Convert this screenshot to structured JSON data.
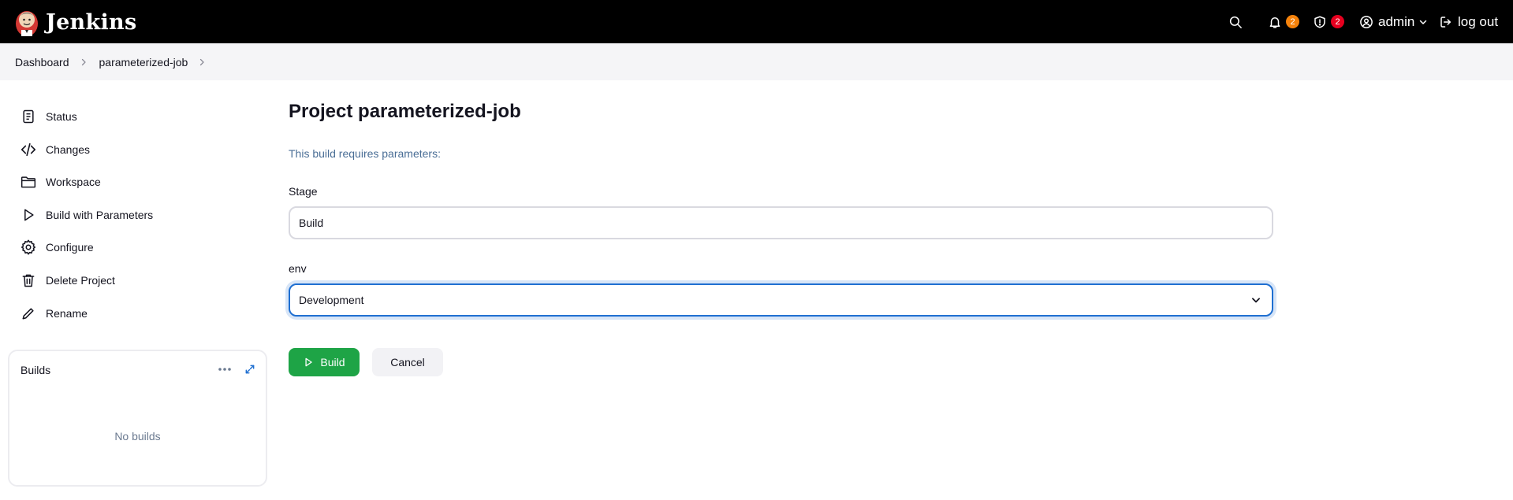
{
  "header": {
    "brand": "Jenkins",
    "notifications_count": "2",
    "security_count": "2",
    "user": "admin",
    "logout": "log out"
  },
  "breadcrumb": [
    "Dashboard",
    "parameterized-job"
  ],
  "sidebar": {
    "items": [
      {
        "label": "Status",
        "icon": "notepad-icon"
      },
      {
        "label": "Changes",
        "icon": "code-icon"
      },
      {
        "label": "Workspace",
        "icon": "folder-icon"
      },
      {
        "label": "Build with Parameters",
        "icon": "play-icon"
      },
      {
        "label": "Configure",
        "icon": "gear-icon"
      },
      {
        "label": "Delete Project",
        "icon": "trash-icon"
      },
      {
        "label": "Rename",
        "icon": "pencil-icon"
      }
    ],
    "builds": {
      "title": "Builds",
      "empty": "No builds"
    }
  },
  "main": {
    "title": "Project parameterized-job",
    "notice": "This build requires parameters:",
    "params": [
      {
        "label": "Stage",
        "value": "Build"
      },
      {
        "label": "env",
        "value": "Development"
      }
    ],
    "build_button": "Build",
    "cancel_button": "Cancel"
  },
  "colors": {
    "header_bg": "#000000",
    "accent_focus": "#1f6fd1",
    "build_green": "#1ea446",
    "badge_orange": "#f5820b",
    "badge_red": "#e6001f"
  }
}
